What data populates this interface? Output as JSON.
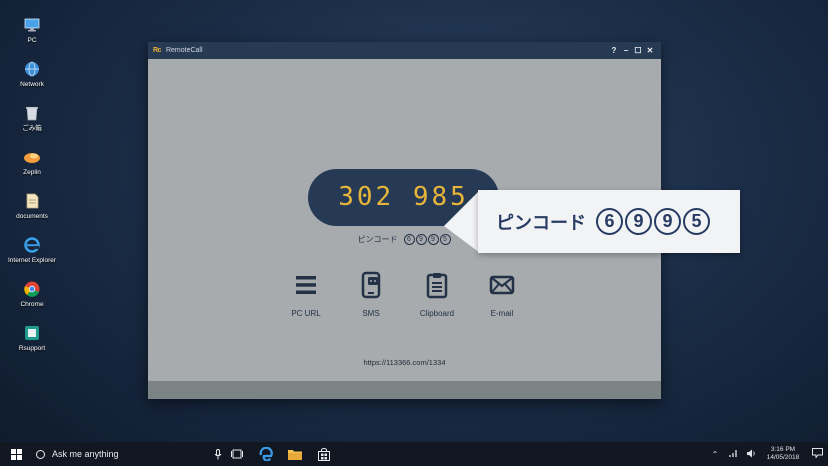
{
  "desktop": {
    "icons": [
      {
        "label": "PC",
        "icon": "pc-icon"
      },
      {
        "label": "Network",
        "icon": "network-icon"
      },
      {
        "label": "ごみ箱",
        "icon": "recycle-bin-icon"
      },
      {
        "label": "Zeplin",
        "icon": "zeplin-icon"
      },
      {
        "label": "documents",
        "icon": "documents-icon"
      },
      {
        "label": "Internet Explorer",
        "icon": "internet-explorer-icon"
      },
      {
        "label": "Chrome",
        "icon": "chrome-icon"
      },
      {
        "label": "Rsupport",
        "icon": "rsupport-icon"
      }
    ]
  },
  "window": {
    "logo": "Rc",
    "title": "RemoteCall",
    "controls": {
      "help": "?",
      "minimize": "−",
      "maximize": "☐",
      "close": "✕"
    },
    "pin_display": "302 985",
    "pin_label": "ピンコード",
    "pin_digits": [
      "6",
      "9",
      "9",
      "5"
    ],
    "actions": [
      {
        "label": "PC URL",
        "icon": "menu-lines-icon"
      },
      {
        "label": "SMS",
        "icon": "sms-phone-icon"
      },
      {
        "label": "Clipboard",
        "icon": "clipboard-icon"
      },
      {
        "label": "E-mail",
        "icon": "envelope-icon"
      }
    ],
    "url": "https://113366.com/1334"
  },
  "callout": {
    "label": "ピンコード",
    "digits": [
      "6",
      "9",
      "9",
      "5"
    ]
  },
  "taskbar": {
    "search_placeholder": "Ask me anything",
    "time": "3:16 PM",
    "date": "14/05/2018"
  },
  "colors": {
    "accent_yellow": "#e7b53a",
    "navy": "#263a55",
    "window_bg": "#a7abae"
  }
}
